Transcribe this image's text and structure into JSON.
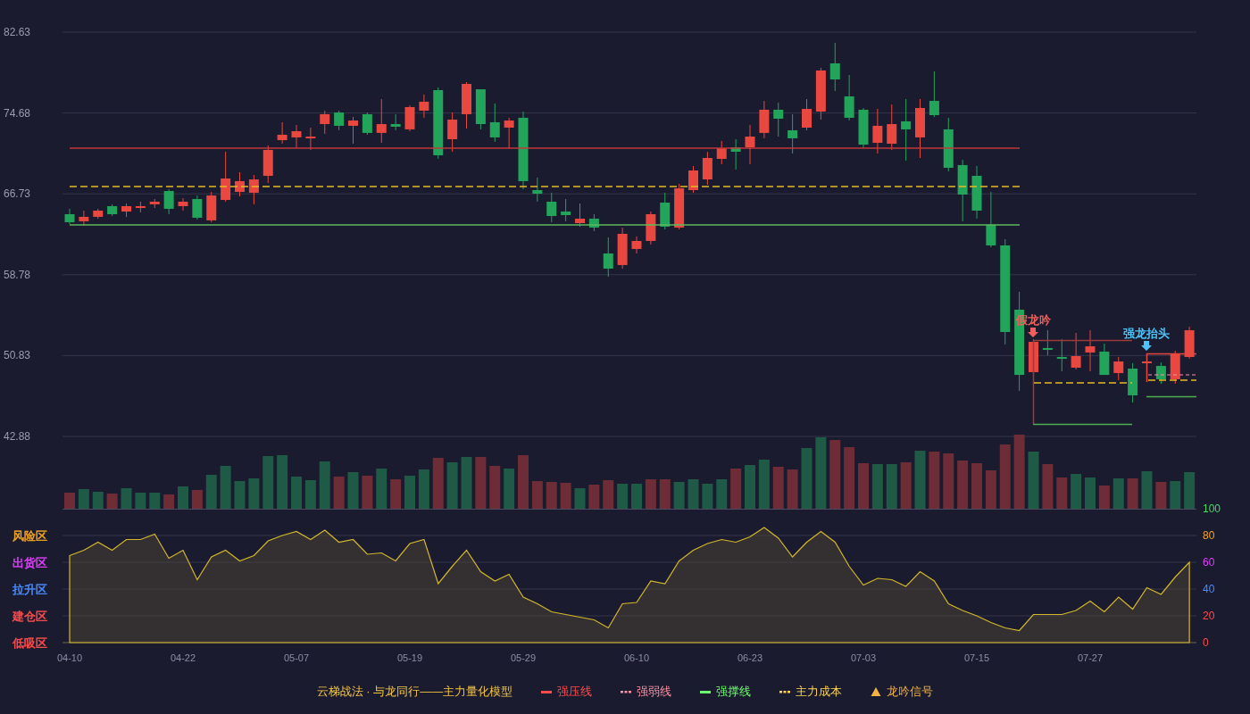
{
  "price_chart": {
    "chart_data": {
      "type": "candlestick",
      "ylim": [
        42.88,
        82.63
      ],
      "yticks": [
        82.63,
        74.68,
        66.73,
        58.78,
        50.83,
        42.88
      ],
      "grid": true,
      "ohlc": [
        [
          64.73,
          65.26,
          63.76,
          63.94
        ],
        [
          64.03,
          65.08,
          63.59,
          64.47
        ],
        [
          64.47,
          65.26,
          64.29,
          65.08
        ],
        [
          65.52,
          65.7,
          64.55,
          64.73
        ],
        [
          64.99,
          65.78,
          64.47,
          65.52
        ],
        [
          65.34,
          65.96,
          64.91,
          65.52
        ],
        [
          65.7,
          66.22,
          65.34,
          65.96
        ],
        [
          67.01,
          67.19,
          64.73,
          65.26
        ],
        [
          65.52,
          66.31,
          65.08,
          65.96
        ],
        [
          66.22,
          66.57,
          64.2,
          64.38
        ],
        [
          64.12,
          66.92,
          63.94,
          66.57
        ],
        [
          66.13,
          70.87,
          65.96,
          68.24
        ],
        [
          66.92,
          68.85,
          66.48,
          67.98
        ],
        [
          66.84,
          68.59,
          65.7,
          68.15
        ],
        [
          68.5,
          71.49,
          67.8,
          71.05
        ],
        [
          72.01,
          73.77,
          71.66,
          72.54
        ],
        [
          72.28,
          73.5,
          71.22,
          72.89
        ],
        [
          72.19,
          73.24,
          71.05,
          72.36
        ],
        [
          73.59,
          74.91,
          72.63,
          74.56
        ],
        [
          74.73,
          74.91,
          72.98,
          73.42
        ],
        [
          73.42,
          74.29,
          71.66,
          73.94
        ],
        [
          74.56,
          74.73,
          72.54,
          72.72
        ],
        [
          72.72,
          76.05,
          71.75,
          73.59
        ],
        [
          73.59,
          74.56,
          72.98,
          73.33
        ],
        [
          73.07,
          75.44,
          72.89,
          75.26
        ],
        [
          74.91,
          76.49,
          74.21,
          75.79
        ],
        [
          76.93,
          77.19,
          70.17,
          70.52
        ],
        [
          72.1,
          74.73,
          70.87,
          74.03
        ],
        [
          74.56,
          77.72,
          73.15,
          77.54
        ],
        [
          77.01,
          77.01,
          73.07,
          73.59
        ],
        [
          73.77,
          75.61,
          71.84,
          72.28
        ],
        [
          73.24,
          74.21,
          71.14,
          73.94
        ],
        [
          74.21,
          74.82,
          67.19,
          67.98
        ],
        [
          67.1,
          68.33,
          65.96,
          66.75
        ],
        [
          65.96,
          66.84,
          63.94,
          64.55
        ],
        [
          64.99,
          66.22,
          64.03,
          64.64
        ],
        [
          63.85,
          65.78,
          63.5,
          64.29
        ],
        [
          64.29,
          64.73,
          63.06,
          63.41
        ],
        [
          60.87,
          62.45,
          58.59,
          59.38
        ],
        [
          59.73,
          63.41,
          59.38,
          62.8
        ],
        [
          61.31,
          62.54,
          60.87,
          62.1
        ],
        [
          62.1,
          64.99,
          61.75,
          64.73
        ],
        [
          65.87,
          66.84,
          63.24,
          63.5
        ],
        [
          63.41,
          67.71,
          63.24,
          67.27
        ],
        [
          67.1,
          69.47,
          66.84,
          69.03
        ],
        [
          68.15,
          70.87,
          67.63,
          70.26
        ],
        [
          70.17,
          71.93,
          69.64,
          71.22
        ],
        [
          71.31,
          72.1,
          69.12,
          70.87
        ],
        [
          71.31,
          73.5,
          69.64,
          72.36
        ],
        [
          72.72,
          75.87,
          72.19,
          75.0
        ],
        [
          75.0,
          75.7,
          72.36,
          74.12
        ],
        [
          72.98,
          74.56,
          70.7,
          72.19
        ],
        [
          73.24,
          76.05,
          72.98,
          75.08
        ],
        [
          74.82,
          79.12,
          74.03,
          78.86
        ],
        [
          79.56,
          81.58,
          76.84,
          77.98
        ],
        [
          76.31,
          78.42,
          73.94,
          74.21
        ],
        [
          75.0,
          75.17,
          71.22,
          71.57
        ],
        [
          71.75,
          75.08,
          70.7,
          73.42
        ],
        [
          71.66,
          75.52,
          71.05,
          73.59
        ],
        [
          73.86,
          76.05,
          69.99,
          73.07
        ],
        [
          72.28,
          76.05,
          70.26,
          75.17
        ],
        [
          75.87,
          78.77,
          74.29,
          74.47
        ],
        [
          73.07,
          74.21,
          68.94,
          69.29
        ],
        [
          69.56,
          70.08,
          64.03,
          66.66
        ],
        [
          68.5,
          69.47,
          64.29,
          65.08
        ],
        [
          63.68,
          66.92,
          61.48,
          61.66
        ],
        [
          61.66,
          62.27,
          51.92,
          53.15
        ],
        [
          55.34,
          57.1,
          47.36,
          48.93
        ],
        [
          49.2,
          52.44,
          49.02,
          52.18
        ],
        [
          51.57,
          53.32,
          50.87,
          51.39
        ],
        [
          50.69,
          52.44,
          49.29,
          50.51
        ],
        [
          49.64,
          53.06,
          49.46,
          50.78
        ],
        [
          51.13,
          53.32,
          49.29,
          51.74
        ],
        [
          51.22,
          52.01,
          48.93,
          48.93
        ],
        [
          49.11,
          50.69,
          48.41,
          50.25
        ],
        [
          49.55,
          50.08,
          46.21,
          46.92
        ],
        [
          50.08,
          50.43,
          49.9,
          50.25
        ],
        [
          49.81,
          50.16,
          48.06,
          48.5
        ],
        [
          48.5,
          51.3,
          48.06,
          51.04
        ],
        [
          50.69,
          53.67,
          50.51,
          53.32
        ]
      ]
    },
    "signals": [
      {
        "label": "假龙吟",
        "color": "#f0605a"
      },
      {
        "label": "强龙抬头",
        "color": "#4fc3f7"
      }
    ]
  },
  "indicator": {
    "zones": [
      {
        "label": "风险区",
        "color": "#f5a623"
      },
      {
        "label": "出货区",
        "color": "#e040fb"
      },
      {
        "label": "拉升区",
        "color": "#4a8cff"
      },
      {
        "label": "建仓区",
        "color": "#ff4d4d"
      },
      {
        "label": "低吸区",
        "color": "#ff4d4d"
      }
    ],
    "chart_data": {
      "type": "area",
      "ylim": [
        0,
        100
      ],
      "yticks": [
        0,
        20,
        40,
        60,
        80,
        100
      ],
      "grid": true,
      "categories": [
        "04-10",
        null,
        null,
        null,
        null,
        null,
        null,
        null,
        "04-22",
        null,
        null,
        null,
        null,
        null,
        null,
        null,
        "05-07",
        null,
        null,
        null,
        null,
        null,
        null,
        null,
        "05-19",
        null,
        null,
        null,
        null,
        null,
        null,
        null,
        "05-29",
        null,
        null,
        null,
        null,
        null,
        null,
        null,
        "06-10",
        null,
        null,
        null,
        null,
        null,
        null,
        null,
        "06-23",
        null,
        null,
        null,
        null,
        null,
        null,
        null,
        "07-03",
        null,
        null,
        null,
        null,
        null,
        null,
        null,
        "07-15",
        null,
        null,
        null,
        null,
        null,
        null,
        null,
        "07-27",
        null,
        null,
        null,
        null,
        null,
        null,
        null
      ],
      "series": [
        {
          "color": "#d4b72a",
          "values": [
            65,
            69,
            75,
            69,
            77,
            77,
            81,
            63,
            69,
            47,
            64,
            69,
            61,
            65,
            76,
            80,
            83,
            77,
            84,
            75,
            77,
            66,
            67,
            61,
            74,
            77,
            44,
            57,
            69,
            53,
            46,
            51,
            34,
            29,
            23,
            21,
            19,
            17,
            11,
            29,
            30,
            46,
            44,
            61,
            69,
            74,
            77,
            75,
            79,
            86,
            78,
            64,
            75,
            83,
            75,
            57,
            43,
            48,
            47,
            42,
            53,
            46,
            29,
            24,
            20,
            15,
            11,
            9,
            21,
            21,
            21,
            24,
            31,
            23,
            34,
            25,
            41,
            36,
            49,
            60
          ]
        }
      ]
    }
  },
  "legend": {
    "title": "云梯战法 · 与龙同行——主力量化模型",
    "items": [
      {
        "label": "强压线",
        "kind": "solid",
        "color": "#ff4d4d"
      },
      {
        "label": "强弱线",
        "kind": "dashed",
        "color": "#ff8fa3"
      },
      {
        "label": "强撑线",
        "kind": "solid",
        "color": "#6cff6c"
      },
      {
        "label": "主力成本",
        "kind": "dashed",
        "color": "#ffd54f"
      },
      {
        "label": "龙吟信号",
        "kind": "triangle",
        "color": "#f5b342"
      }
    ]
  }
}
